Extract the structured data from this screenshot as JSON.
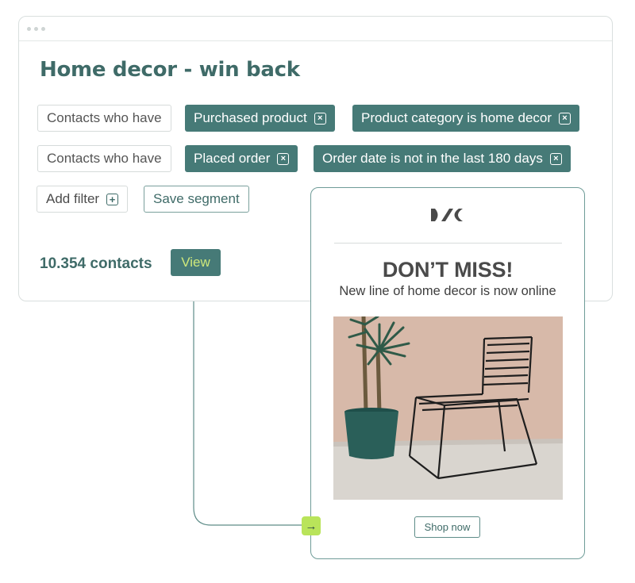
{
  "segment": {
    "title": "Home decor - win back",
    "rows": [
      {
        "prefix": "Contacts who have",
        "filters": [
          "Purchased product",
          "Product category is home decor"
        ]
      },
      {
        "prefix": "Contacts who have",
        "filters": [
          "Placed order",
          "Order date is not in the last 180 days"
        ]
      }
    ],
    "add_filter_label": "Add filter",
    "save_segment_label": "Save segment",
    "contact_count": "10.354 contacts",
    "view_label": "View"
  },
  "email": {
    "headline": "DON’T MISS!",
    "subline": "New line of home decor is now online",
    "cta_label": "Shop now",
    "image_description_icon": "chair-and-plant-photo"
  },
  "colors": {
    "brand_teal": "#467a77",
    "accent_lime": "#b9e45a",
    "text_teal": "#3f6b68"
  }
}
